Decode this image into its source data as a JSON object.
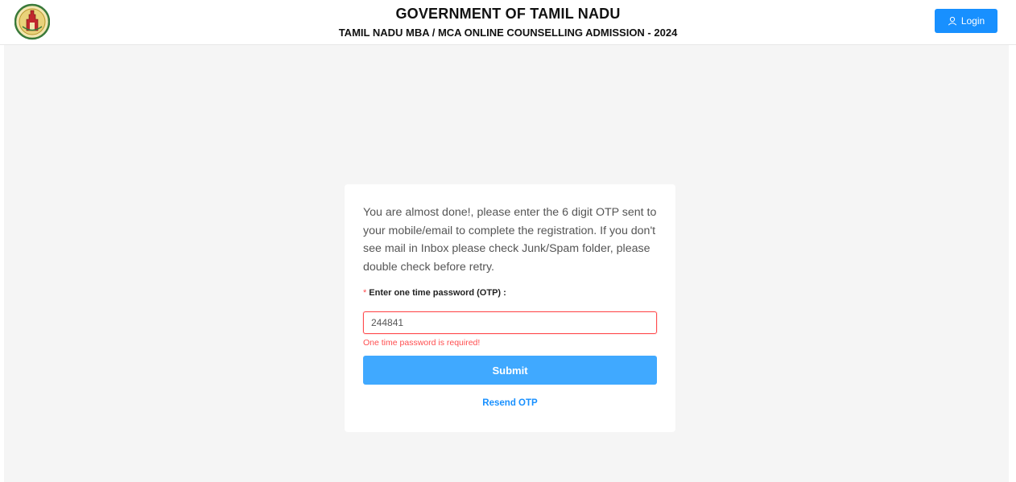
{
  "header": {
    "title": "GOVERNMENT OF TAMIL NADU",
    "subtitle": "TAMIL NADU MBA / MCA ONLINE COUNSELLING ADMISSION - 2024",
    "login_label": "Login",
    "emblem_icon": "tamil-nadu-emblem-icon",
    "login_icon": "user-icon"
  },
  "otp_form": {
    "message": "You are almost done!, please enter the 6 digit OTP sent to your mobile/email to complete the registration. If you don't see mail in Inbox please check Junk/Spam folder, please double check before retry.",
    "required_marker": "*",
    "label": "Enter one time password (OTP) :",
    "otp_value": "244841",
    "error": "One time password is required!",
    "submit_label": "Submit",
    "resend_label": "Resend OTP"
  },
  "colors": {
    "primary": "#1890ff",
    "submit": "#40a9ff",
    "error": "#ff4d4f",
    "background": "#f5f5f5"
  }
}
